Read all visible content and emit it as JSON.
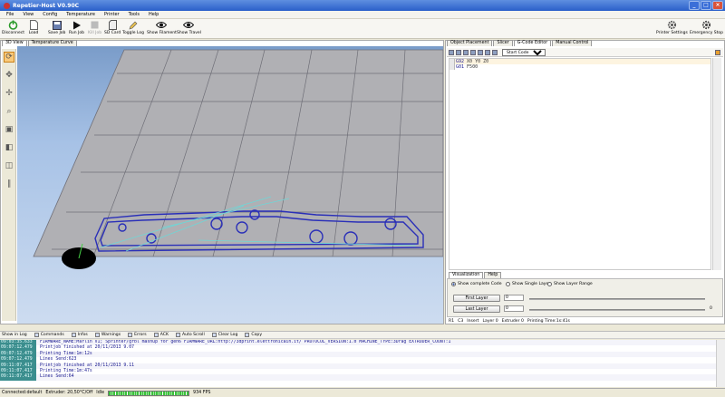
{
  "window": {
    "title": "Repetier-Host V0.90C"
  },
  "menu": [
    "File",
    "View",
    "Config",
    "Temperature",
    "Printer",
    "Tools",
    "Help"
  ],
  "toolbar": {
    "disconnect": "Disconnect",
    "load": "Load",
    "save_job": "Save Job",
    "run_job": "Run Job",
    "kill_job": "Kill Job",
    "sd_card": "SD Card",
    "toggle_log": "Toggle Log",
    "show_filament": "Show Filament",
    "show_travel": "Show Travel",
    "printer_settings": "Printer Settings",
    "emergency_stop": "Emergency Stop"
  },
  "left_tabs": [
    "3D View",
    "Temperature Curve"
  ],
  "right_tabs": [
    "Object Placement",
    "Slicer",
    "G-Code Editor",
    "Manual Control"
  ],
  "gcode_editor": {
    "selector_value": "Start Code",
    "lines": [
      {
        "cmd": "G92",
        "args": "X0 Y0 Z0"
      },
      {
        "cmd": "G01",
        "args": "F500"
      }
    ]
  },
  "visualization": {
    "tabs": [
      "Visualization",
      "Help"
    ],
    "options": [
      "Show complete Code",
      "Show Single Layer",
      "Show Layer Range"
    ],
    "selected_option": "Show complete Code",
    "first_layer_label": "First Layer",
    "first_layer_value": "0",
    "last_layer_label": "Last Layer",
    "last_layer_value": "0",
    "last_layer_max": "0"
  },
  "editor_status": {
    "line": "R1",
    "col": "C3",
    "mode": "Insert",
    "layer": "Layer 0",
    "extruder": "Extruder 0",
    "print_time": "Printing Time:1s:41s"
  },
  "log_toolbar": [
    "Show in Log",
    "Commands",
    "Infos",
    "Warnings",
    "Errors",
    "ACK",
    "Auto Scroll",
    "Clear Log",
    "Copy"
  ],
  "log": [
    {
      "time": "09:03:35.633",
      "msg": "FIRMWARE_NAME:Marlin V1; Sprinter/grbl mashup for gen6 FIRMWARE_URL:http://3dprint.elettronicain.it/ PROTOCOL_VERSION:1.0 MACHINE_TYPE:3Drag EXTRUDER_COUNT:1"
    },
    {
      "time": "09:07:12.479",
      "msg": "Printjob finished at 20/11/2013 9.07"
    },
    {
      "time": "09:07:12.479",
      "msg": "Printing Time:1m:12s"
    },
    {
      "time": "09:07:12.479",
      "msg": "Lines Send:623"
    },
    {
      "time": "09:11:07.417",
      "msg": "Printjob finished at 20/11/2013 9.11"
    },
    {
      "time": "09:11:07.417",
      "msg": "Printing Time:1m:47s"
    },
    {
      "time": "09:11:07.417",
      "msg": "Lines Send:64"
    }
  ],
  "statusbar": {
    "connection": "Connected:default",
    "extruder": "Extruder: 20,50°C/Off",
    "state": "Idle",
    "progress": 1.0,
    "fps": "934 FPS"
  }
}
